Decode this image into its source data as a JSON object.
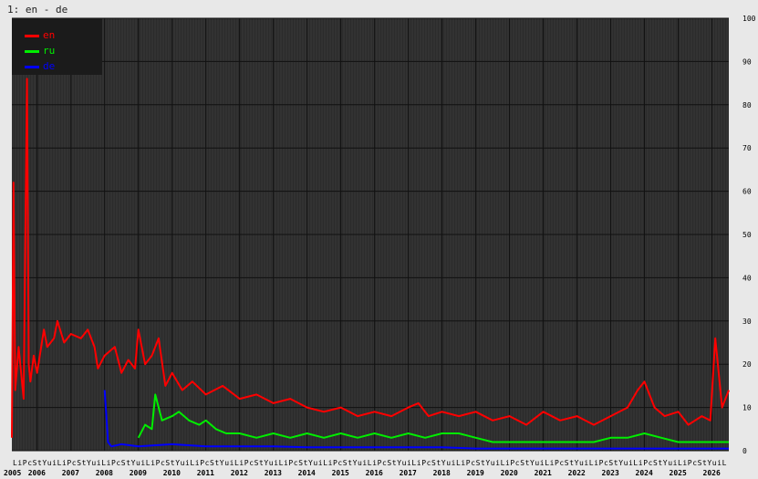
{
  "window_title": "1: en - de",
  "colors": {
    "background": "#e8e8e8",
    "plot_background": "#2b2b2b",
    "grid": "#111111",
    "stripe": "#555555",
    "en": "#ff0000",
    "ru": "#00ee00",
    "de": "#0000ff",
    "axis_text": "#000000"
  },
  "chart_data": {
    "type": "line",
    "title": "1: en - de",
    "ylim": [
      0,
      100
    ],
    "yticks": [
      0,
      10,
      20,
      30,
      40,
      50,
      60,
      70,
      80,
      90,
      100
    ],
    "ytick_labels": [
      "0",
      "10",
      "20",
      "30",
      "40",
      "50",
      "60",
      "70",
      "80",
      "90",
      "100"
    ],
    "xlim": [
      2005.25,
      2026.5
    ],
    "year_labels": [
      "2005",
      "2006",
      "2007",
      "2008",
      "2009",
      "2010",
      "2011",
      "2012",
      "2013",
      "2014",
      "2015",
      "2016",
      "2017",
      "2018",
      "2019",
      "2020",
      "2021",
      "2022",
      "2023",
      "2024",
      "2025",
      "2026"
    ],
    "year_positions": [
      2005.25,
      2006,
      2007,
      2008,
      2009,
      2010,
      2011,
      2012,
      2013,
      2014,
      2015,
      2016,
      2017,
      2018,
      2019,
      2020,
      2021,
      2022,
      2023,
      2024,
      2025,
      2026
    ],
    "month_letters": [
      "L",
      "i",
      "P",
      "c",
      "S",
      "t",
      "Y",
      "u",
      "i"
    ],
    "grid": true,
    "legend": "top-left",
    "series": [
      {
        "name": "en",
        "color": "#ff0000",
        "x": [
          2005.25,
          2005.3,
          2005.35,
          2005.45,
          2005.6,
          2005.7,
          2005.75,
          2005.8,
          2005.9,
          2006.0,
          2006.2,
          2006.3,
          2006.5,
          2006.6,
          2006.8,
          2007.0,
          2007.3,
          2007.5,
          2007.7,
          2007.8,
          2008.0,
          2008.3,
          2008.5,
          2008.7,
          2008.9,
          2009.0,
          2009.2,
          2009.4,
          2009.6,
          2009.8,
          2010.0,
          2010.3,
          2010.6,
          2011.0,
          2011.5,
          2012.0,
          2012.5,
          2013.0,
          2013.5,
          2014.0,
          2014.5,
          2015.0,
          2015.5,
          2016.0,
          2016.5,
          2017.0,
          2017.3,
          2017.6,
          2018.0,
          2018.5,
          2019.0,
          2019.5,
          2020.0,
          2020.5,
          2021.0,
          2021.5,
          2022.0,
          2022.5,
          2023.0,
          2023.5,
          2023.8,
          2024.0,
          2024.3,
          2024.6,
          2025.0,
          2025.3,
          2025.7,
          2025.95,
          2026.1,
          2026.3,
          2026.5
        ],
        "values": [
          3,
          62,
          14,
          24,
          12,
          86,
          20,
          16,
          22,
          18,
          28,
          24,
          26,
          30,
          25,
          27,
          26,
          28,
          24,
          19,
          22,
          24,
          18,
          21,
          19,
          28,
          20,
          22,
          26,
          15,
          18,
          14,
          16,
          13,
          15,
          12,
          13,
          11,
          12,
          10,
          9,
          10,
          8,
          9,
          8,
          10,
          11,
          8,
          9,
          8,
          9,
          7,
          8,
          6,
          9,
          7,
          8,
          6,
          8,
          10,
          14,
          16,
          10,
          8,
          9,
          6,
          8,
          7,
          26,
          10,
          14
        ]
      },
      {
        "name": "ru",
        "color": "#00ee00",
        "x": [
          2009.0,
          2009.2,
          2009.4,
          2009.5,
          2009.7,
          2010.0,
          2010.2,
          2010.5,
          2010.8,
          2011.0,
          2011.3,
          2011.6,
          2012.0,
          2012.5,
          2013.0,
          2013.5,
          2014.0,
          2014.5,
          2015.0,
          2015.5,
          2016.0,
          2016.5,
          2017.0,
          2017.5,
          2018.0,
          2018.5,
          2019.0,
          2019.5,
          2020.0,
          2020.5,
          2021.0,
          2021.5,
          2022.0,
          2022.5,
          2023.0,
          2023.5,
          2024.0,
          2024.5,
          2025.0,
          2025.5,
          2026.0,
          2026.5
        ],
        "values": [
          3,
          6,
          5,
          13,
          7,
          8,
          9,
          7,
          6,
          7,
          5,
          4,
          4,
          3,
          4,
          3,
          4,
          3,
          4,
          3,
          4,
          3,
          4,
          3,
          4,
          4,
          3,
          2,
          2,
          2,
          2,
          2,
          2,
          2,
          3,
          3,
          4,
          3,
          2,
          2,
          2,
          2
        ]
      },
      {
        "name": "de",
        "color": "#0000ff",
        "x": [
          2008.0,
          2008.05,
          2008.1,
          2008.2,
          2008.5,
          2009.0,
          2010.0,
          2011.0,
          2012.0,
          2013.0,
          2014.0,
          2015.0,
          2016.0,
          2017.0,
          2018.0,
          2019.0,
          2020.0,
          2021.0,
          2022.0,
          2023.0,
          2024.0,
          2025.0,
          2026.0,
          2026.5
        ],
        "values": [
          14,
          8,
          2,
          1,
          1.5,
          1,
          1.5,
          1,
          1,
          1,
          0.8,
          0.8,
          0.8,
          0.8,
          0.8,
          0.5,
          0.5,
          0.5,
          0.5,
          0.5,
          0.5,
          0.5,
          0.5,
          0.5
        ]
      }
    ]
  }
}
